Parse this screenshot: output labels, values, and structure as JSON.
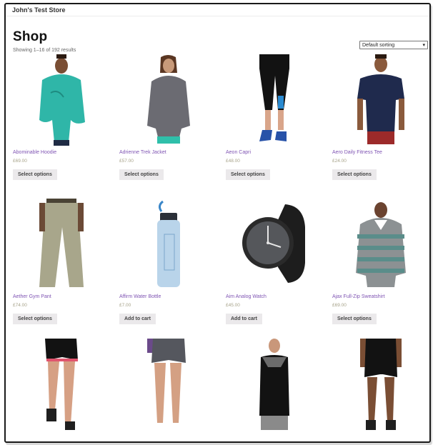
{
  "store": {
    "name": "John's Test Store"
  },
  "shop": {
    "title": "Shop",
    "result_count": "Showing 1–16 of 192 results",
    "sorting": "Default sorting"
  },
  "products": [
    {
      "title": "Abominable Hoodie",
      "price": "£69.00",
      "button": "Select options",
      "image": "teal-hoodie-man"
    },
    {
      "title": "Adrienne Trek Jacket",
      "price": "£57.00",
      "button": "Select options",
      "image": "grey-jacket-woman"
    },
    {
      "title": "Aeon Capri",
      "price": "£48.00",
      "button": "Select options",
      "image": "black-capri-legs"
    },
    {
      "title": "Aero Daily Fitness Tee",
      "price": "£24.00",
      "button": "Select options",
      "image": "navy-tee-man"
    },
    {
      "title": "Aether Gym Pant",
      "price": "£74.00",
      "button": "Select options",
      "image": "khaki-pants"
    },
    {
      "title": "Affirm Water Bottle",
      "price": "£7.00",
      "button": "Add to cart",
      "image": "water-bottle"
    },
    {
      "title": "Aim Analog Watch",
      "price": "£45.00",
      "button": "Add to cart",
      "image": "black-watch"
    },
    {
      "title": "Ajax Full-Zip Sweatshirt",
      "price": "£69.00",
      "button": "Select options",
      "image": "striped-hoodie-man"
    },
    {
      "title": "",
      "price": "",
      "button": "",
      "image": "black-shorts-legs"
    },
    {
      "title": "",
      "price": "",
      "button": "",
      "image": "grey-shorts-legs"
    },
    {
      "title": "",
      "price": "",
      "button": "",
      "image": "black-tank-woman"
    },
    {
      "title": "",
      "price": "",
      "button": "",
      "image": "black-shorts-man"
    }
  ],
  "colors": {
    "link": "#7f54b3",
    "price": "#a7a38a",
    "button_bg": "#ebe9eb"
  }
}
